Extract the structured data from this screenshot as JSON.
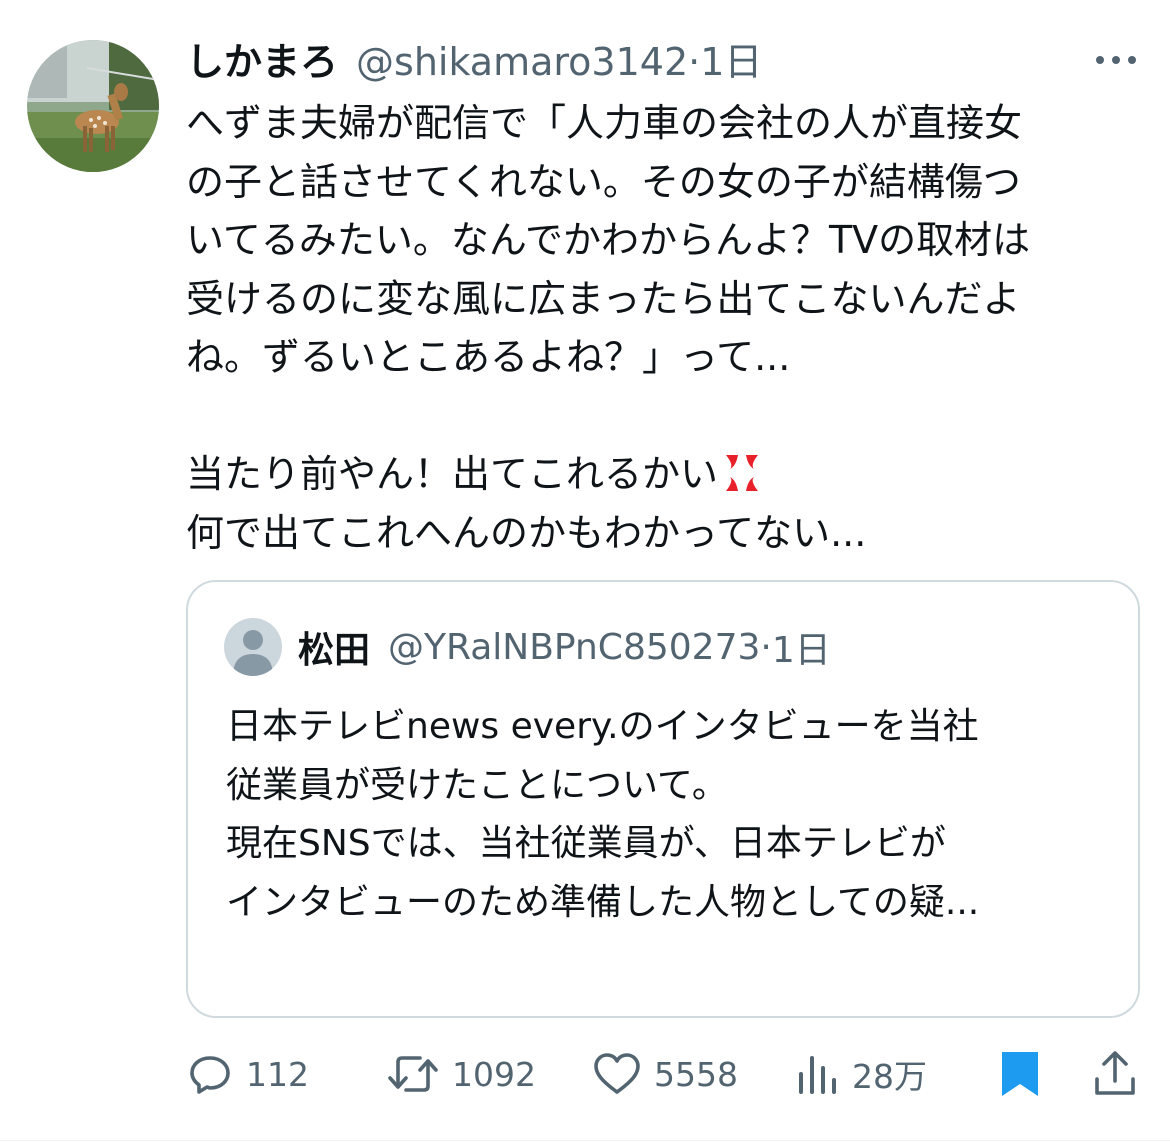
{
  "tweet": {
    "display_name": "しかまろ",
    "handle": "@shikamaro3142",
    "separator": "·",
    "time": "1日",
    "avatar_icon": "deer-photo-avatar",
    "more_icon": "more-dots-icon",
    "body_lines": [
      "へずま夫婦が配信で「人力車の会社の人が直接女",
      "の子と話させてくれない。その女の子が結構傷つ",
      "いてるみたい。なんでかわからんよ？TVの取材は",
      "受けるのに変な風に広まったら出てこないんだよ",
      "ね。ずるいとこあるよね？」って..."
    ],
    "body_line_6": "当たり前やん！出てこれるかい",
    "body_line_6_emoji": "anger-symbol-icon",
    "body_line_7": "何で出てこれへんのかもわかってない..."
  },
  "quote": {
    "display_name": "松田",
    "handle": "@YRalNBPnC850273",
    "separator": "·",
    "time": "1日",
    "avatar_icon": "default-user-avatar",
    "lines": [
      "日本テレビnews every.のインタビューを当社",
      "従業員が受けたことについて。",
      "",
      "現在SNSでは、当社従業員が、日本テレビが",
      "インタビューのため準備した人物としての疑..."
    ]
  },
  "actions": {
    "replies": "112",
    "retweets": "1092",
    "likes": "5558",
    "views": "28万"
  },
  "colors": {
    "text": "#0f1419",
    "secondary": "#536471",
    "border": "#cfd9de",
    "bookmark": "#1d9bf0",
    "anger": "#e8202a"
  }
}
